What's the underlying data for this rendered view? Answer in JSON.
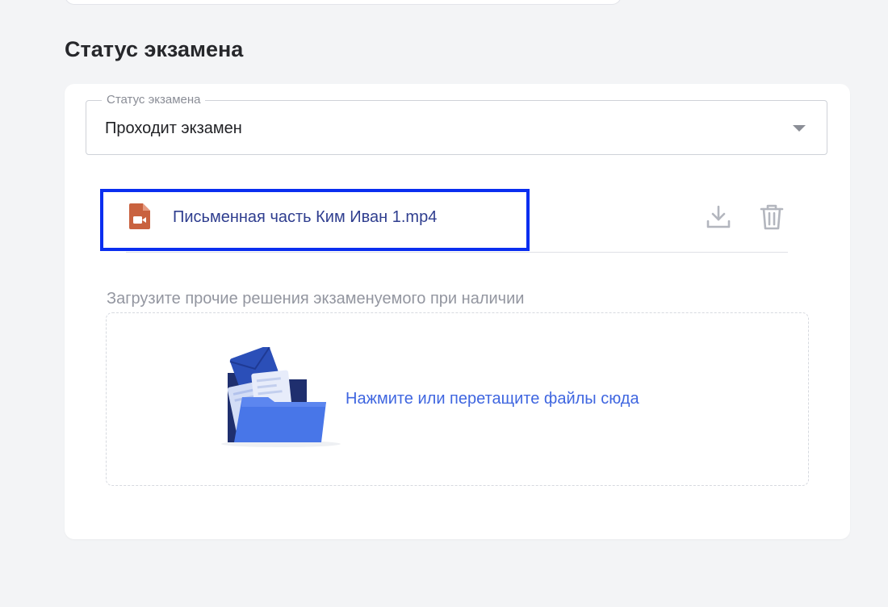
{
  "section": {
    "title": "Статус экзамена"
  },
  "status_select": {
    "label": "Статус экзамена",
    "value": "Проходит экзамен"
  },
  "file": {
    "name": "Письменная часть Ким Иван 1.mp4",
    "type_icon": "video-file-icon"
  },
  "upload": {
    "label": "Загрузите прочие решения экзаменуемого при наличии",
    "dropzone_text": "Нажмите или перетащите файлы сюда",
    "illustration": "folder-illustration"
  },
  "colors": {
    "highlight": "#0a2ef0",
    "file_name": "#2f3e8f",
    "dropzone_text": "#3f66e0",
    "file_icon": "#c9623f"
  }
}
